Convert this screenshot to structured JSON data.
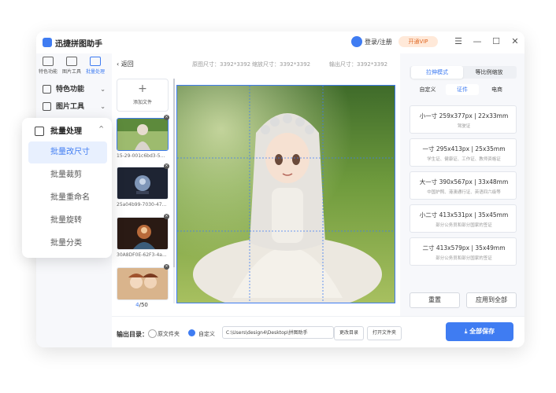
{
  "app": {
    "title": "迅捷拼图助手",
    "user_label": "登录/注册",
    "vip_label": "开通VIP",
    "menu_glyph": "☰",
    "min_glyph": "—",
    "max_glyph": "☐",
    "close_glyph": "✕"
  },
  "topicons": [
    {
      "label": "特色功能"
    },
    {
      "label": "图片工具"
    },
    {
      "label": "批量处理"
    }
  ],
  "nav": {
    "items": [
      {
        "label": "特色功能",
        "chev": "⌄"
      },
      {
        "label": "图片工具",
        "chev": "⌄"
      }
    ]
  },
  "panel": {
    "heading": "批量处理",
    "chev": "^",
    "items": [
      {
        "label": "批量改尺寸"
      },
      {
        "label": "批量裁剪"
      },
      {
        "label": "批量重命名"
      },
      {
        "label": "批量旋转"
      },
      {
        "label": "批量分类"
      }
    ]
  },
  "editor": {
    "back_label": "返回",
    "original_size": "原图尺寸：3392*3392",
    "scaled_size": "缩放尺寸：3392*3392",
    "output_size": "输出尺寸：3392*3392",
    "add_plus": "+",
    "add_label": "添加文件",
    "close_glyph": "×",
    "thumbs": [
      {
        "name": "15-29-001c6bd3-5..."
      },
      {
        "name": "25a04b99-7030-47..."
      },
      {
        "name": "30A8DF0E-62F3-4a..."
      },
      {
        "name": ""
      }
    ],
    "counter_current": "4",
    "counter_total": "/50"
  },
  "bottom": {
    "output_label": "输出目录：",
    "option_source": "原文件夹",
    "option_custom": "自定义",
    "path": "C:\\Users\\design4\\Desktop\\拼图助手",
    "change_dir": "更改目录",
    "open_folder": "打开文件夹",
    "save_all": "全部保存"
  },
  "right": {
    "mode_tabs": [
      {
        "label": "拉伸模式",
        "active": true
      },
      {
        "label": "等比例缩放",
        "active": false
      }
    ],
    "category_tabs": [
      {
        "label": "自定义",
        "active": false
      },
      {
        "label": "证件",
        "active": true
      },
      {
        "label": "电商",
        "active": false
      }
    ],
    "cards": [
      {
        "title": "小一寸 259x377px | 22x33mm",
        "sub": "驾驶证"
      },
      {
        "title": "一寸 295x413px | 25x35mm",
        "sub": "学生证、健康证、工作证、教师资格证"
      },
      {
        "title": "大一寸 390x567px | 33x48mm",
        "sub": "中国护照、港澳通行证、英语四六级等"
      },
      {
        "title": "小二寸 413x531px | 35x45mm",
        "sub": "部分公务员和部分国家的签证"
      },
      {
        "title": "二寸 413x579px | 35x49mm",
        "sub": "部分公务员和部分国家的签证"
      }
    ],
    "reset": "重置",
    "apply_all": "应用到全部"
  },
  "colors": {
    "accent": "#3f7cf2",
    "vip_bg": "#ffe9d9",
    "vip_text": "#e06a26"
  }
}
